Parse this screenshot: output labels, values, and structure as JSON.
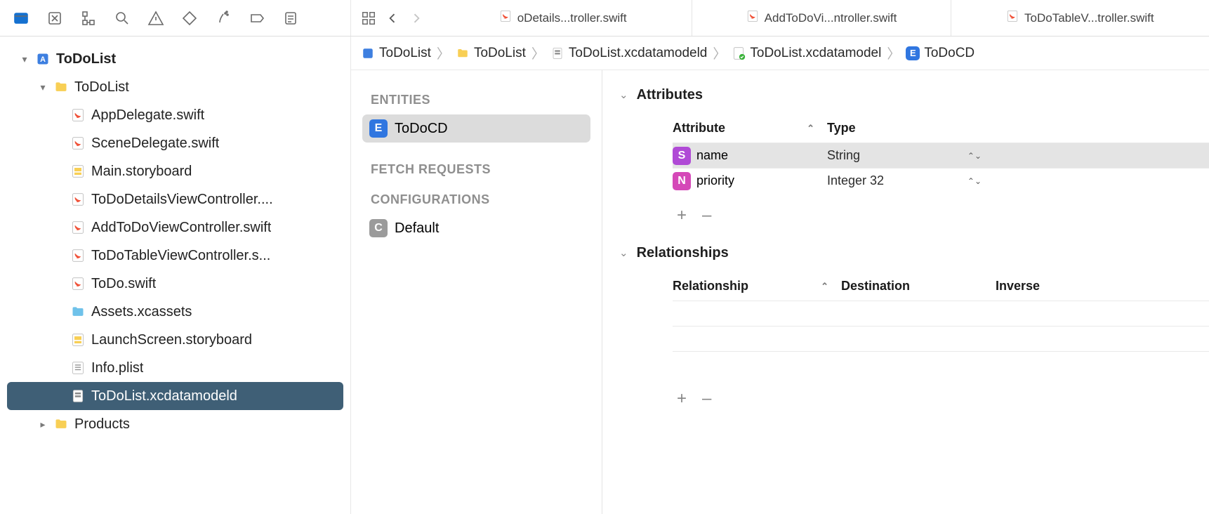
{
  "toolbar": {
    "icons": [
      "folder",
      "window",
      "hierarchy",
      "search",
      "warning",
      "diamond",
      "spray",
      "tag",
      "list"
    ]
  },
  "nav": {
    "grid": "grid-icon",
    "back": "back",
    "fwd": "forward"
  },
  "tabs": [
    {
      "label": "oDetails...troller.swift",
      "icon": "swift"
    },
    {
      "label": "AddToDoVi...ntroller.swift",
      "icon": "swift"
    },
    {
      "label": "ToDoTableV...troller.swift",
      "icon": "swift"
    }
  ],
  "breadcrumb": [
    {
      "label": "ToDoList",
      "icon": "app"
    },
    {
      "label": "ToDoList",
      "icon": "folder"
    },
    {
      "label": "ToDoList.xcdatamodeld",
      "icon": "datamodel"
    },
    {
      "label": "ToDoList.xcdatamodel",
      "icon": "datamodel-ok"
    },
    {
      "label": "ToDoCD",
      "icon": "E"
    }
  ],
  "tree": {
    "root": {
      "label": "ToDoList",
      "icon": "app"
    },
    "group": {
      "label": "ToDoList",
      "icon": "folder"
    },
    "files": [
      {
        "label": "AppDelegate.swift",
        "icon": "swift"
      },
      {
        "label": "SceneDelegate.swift",
        "icon": "swift"
      },
      {
        "label": "Main.storyboard",
        "icon": "storyboard"
      },
      {
        "label": "ToDoDetailsViewController....",
        "icon": "swift"
      },
      {
        "label": "AddToDoViewController.swift",
        "icon": "swift"
      },
      {
        "label": "ToDoTableViewController.s...",
        "icon": "swift"
      },
      {
        "label": "ToDo.swift",
        "icon": "swift"
      },
      {
        "label": "Assets.xcassets",
        "icon": "assets"
      },
      {
        "label": "LaunchScreen.storyboard",
        "icon": "storyboard"
      },
      {
        "label": "Info.plist",
        "icon": "plist"
      },
      {
        "label": "ToDoList.xcdatamodeld",
        "icon": "datamodel",
        "selected": true
      }
    ],
    "products": {
      "label": "Products",
      "icon": "folder"
    }
  },
  "entitiesPane": {
    "entities_label": "ENTITIES",
    "entity": "ToDoCD",
    "fetch_label": "FETCH REQUESTS",
    "config_label": "CONFIGURATIONS",
    "config_default": "Default"
  },
  "attributes": {
    "title": "Attributes",
    "header_a": "Attribute",
    "header_b": "Type",
    "rows": [
      {
        "badge": "S",
        "name": "name",
        "type": "String",
        "selected": true
      },
      {
        "badge": "N",
        "name": "priority",
        "type": "Integer 32"
      }
    ],
    "add": "+",
    "remove": "–"
  },
  "relationships": {
    "title": "Relationships",
    "header_a": "Relationship",
    "header_b": "Destination",
    "header_c": "Inverse",
    "add": "+",
    "remove": "–"
  }
}
